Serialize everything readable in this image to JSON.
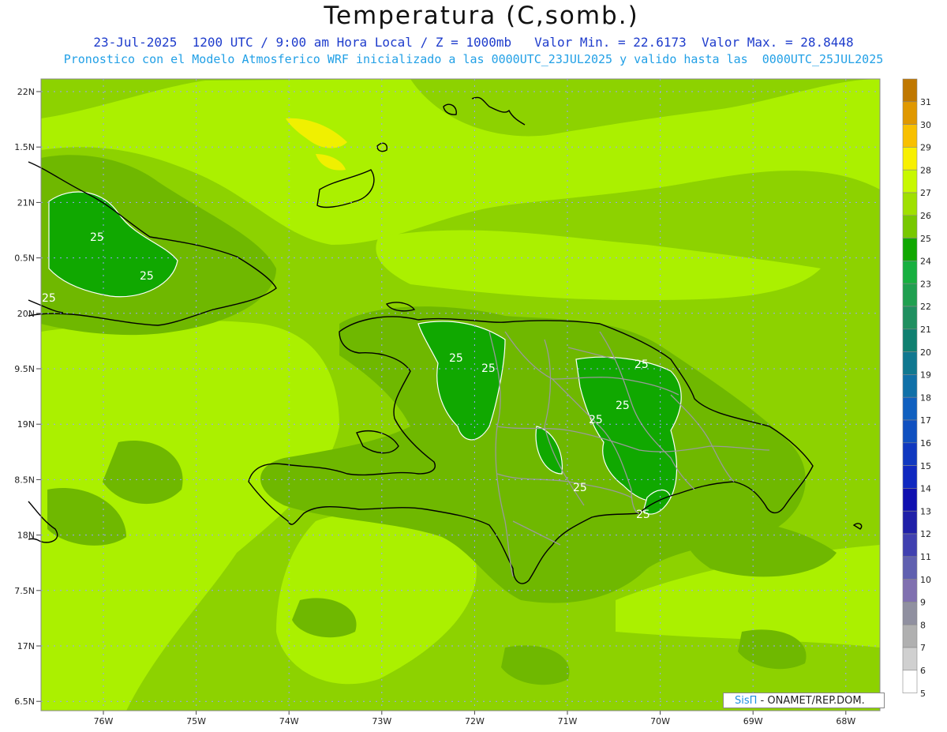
{
  "header": {
    "title": "Temperatura (C,somb.)",
    "line1": "23-Jul-2025  1200 UTC / 9:00 am Hora Local / Z = 1000mb   Valor Min. = 22.6173  Valor Max. = 28.8448",
    "line2": "Pronostico con el Modelo Atmosferico WRF inicializado a las 0000UTC_23JUL2025 y valido hasta las  0000UTC_25JUL2025"
  },
  "axes": {
    "lat_labels": [
      "22N",
      "1.5N",
      "21N",
      "0.5N",
      "20N",
      "9.5N",
      "19N",
      "8.5N",
      "18N",
      "7.5N",
      "17N",
      "6.5N"
    ],
    "lon_labels": [
      "76W",
      "75W",
      "74W",
      "73W",
      "72W",
      "71W",
      "70W",
      "69W",
      "68W"
    ]
  },
  "colorbar": {
    "labels": [
      "31",
      "30",
      "29",
      "28",
      "27",
      "26",
      "25",
      "24",
      "23",
      "22",
      "21",
      "20",
      "19",
      "18",
      "17",
      "16",
      "15",
      "14",
      "13",
      "12",
      "11",
      "10",
      "9",
      "8",
      "7",
      "6",
      "5"
    ],
    "colors": [
      "#c07800",
      "#e09800",
      "#f8c000",
      "#f8f000",
      "#c8f800",
      "#a0e000",
      "#78c800",
      "#10a800",
      "#18b040",
      "#20a050",
      "#209060",
      "#108070",
      "#107890",
      "#1070a8",
      "#1060c0",
      "#1050c0",
      "#1038c0",
      "#1028c0",
      "#1010b0",
      "#2020a8",
      "#4040b0",
      "#6060b0",
      "#8070b0",
      "#9090a0",
      "#b0b0b0",
      "#d0d0d0",
      "#ffffff"
    ]
  },
  "contour_labels": [
    "25",
    "25",
    "25",
    "25",
    "25",
    "25",
    "25",
    "25",
    "25",
    "25"
  ],
  "colors": {
    "background": "#8dd200",
    "lighter": "#abf000",
    "darker": "#6fb800",
    "deep": "#10a800",
    "yellow": "#f0f000"
  },
  "credit": {
    "brand": "SisΠ",
    "text": " - ONAMET/REP.DOM."
  }
}
